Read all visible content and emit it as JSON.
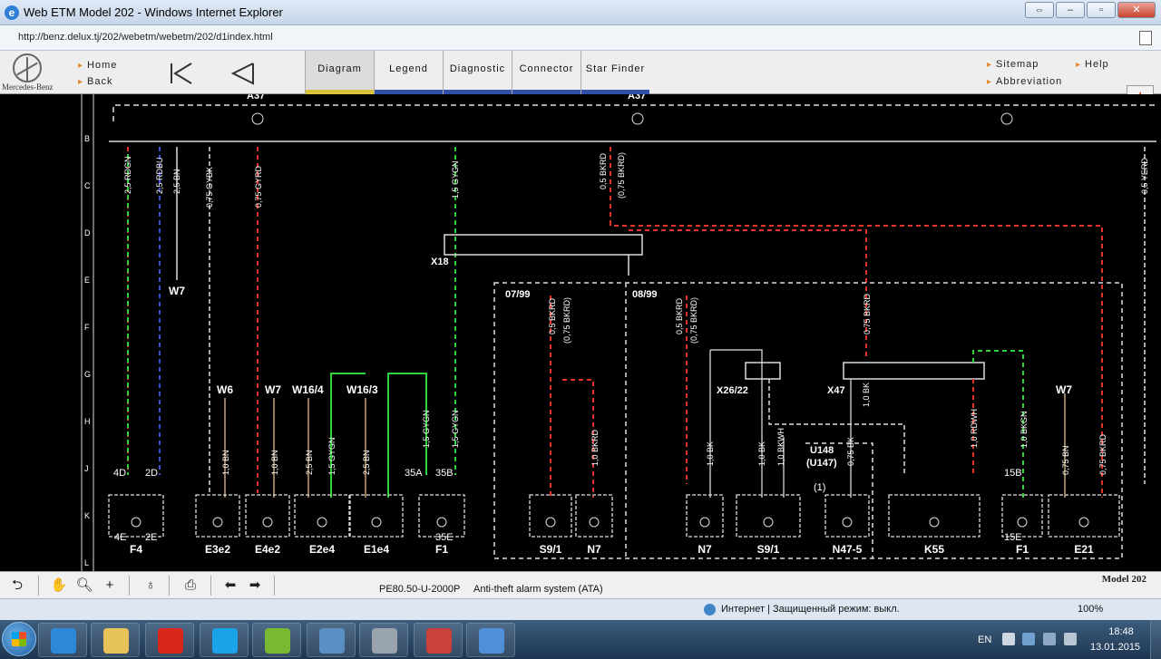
{
  "window": {
    "title": "Web ETM Model 202 - Windows Internet Explorer",
    "url": "http://benz.delux.tj/202/webetm/webetm/202/d1index.html"
  },
  "nav": {
    "brand": "Mercedes-Benz",
    "home": "Home",
    "back": "Back",
    "tabs": [
      {
        "label": "Diagram",
        "bar_color": "#d8c23a"
      },
      {
        "label": "Legend",
        "bar_color": "#2f4fa8"
      },
      {
        "label": "Diagnostic",
        "bar_color": "#2f4fa8"
      },
      {
        "label": "Connector",
        "bar_color": "#2f4fa8"
      },
      {
        "label": "Star Finder",
        "bar_color": "#2f4fa8"
      }
    ],
    "sitemap": "Sitemap",
    "help": "Help",
    "abbreviation": "Abbreviation"
  },
  "diagram": {
    "row_letters": [
      "B",
      "C",
      "D",
      "E",
      "F",
      "G",
      "H",
      "J",
      "K",
      "L"
    ],
    "top_labels": [
      "A37",
      "A37"
    ],
    "connector_labels": [
      "X18",
      "X26/22",
      "X47"
    ],
    "date_labels": [
      "07/99",
      "08/99"
    ],
    "ground_labels": [
      "W7",
      "W6",
      "W7",
      "W16/4",
      "W16/3",
      "W7"
    ],
    "module_labels": [
      "U148",
      "(U147)",
      "(1)"
    ],
    "bottom_components": [
      "F4",
      "E3e2",
      "E4e2",
      "E2e4",
      "E1e4",
      "F1",
      "S9/1",
      "N7",
      "N7",
      "S9/1",
      "N47-5",
      "K55",
      "F1",
      "E21"
    ],
    "fuse_labels": [
      "4D",
      "2D",
      "4E",
      "2E",
      "35A",
      "35B",
      "35E",
      "15B",
      "15E"
    ],
    "wire_labels": [
      "2,5 RDGN",
      "2,5 RDBU",
      "2,5 BN",
      "0,75 GYBK",
      "0,75 GYRD",
      "1,5 GYGN",
      "0,5 BKRD",
      "(0,75 BKRD)",
      "0,5 YERD",
      "0,5 BKRD",
      "(0,75 BKRD)",
      "0,5 BKRD",
      "(0,75 BKRD)",
      "0,75 BKRD",
      "1,0 BN",
      "1,0 BN",
      "2,5 BN",
      "1,5 GYGN",
      "2,5 BN",
      "1,5 GYGN",
      "1,5 GYGN",
      "1,0 BKRD",
      "1,0 BK",
      "1,0 BK",
      "1,0 BKWH",
      "0,75 BK",
      "1,0 BK",
      "1,0 RDWH",
      "1,0 BKGN",
      "0,75 BN",
      "0,75 BKRD"
    ]
  },
  "toolbar": {
    "doc_code": "PE80.50-U-2000P",
    "doc_title": "Anti-theft alarm system (ATA)",
    "model": "Model 202"
  },
  "status": {
    "zone": "Интернет | Защищенный режим: выкл.",
    "zoom": "100%"
  },
  "taskbar": {
    "lang": "EN",
    "time": "18:48",
    "date": "13.01.2015",
    "apps": [
      {
        "name": "internet-explorer",
        "color": "#2e88d8"
      },
      {
        "name": "file-explorer",
        "color": "#e8c35a"
      },
      {
        "name": "opera",
        "color": "#d9261c"
      },
      {
        "name": "skype",
        "color": "#1aa3e8"
      },
      {
        "name": "utorrent",
        "color": "#78b832"
      },
      {
        "name": "photo-viewer",
        "color": "#5a8fc4"
      },
      {
        "name": "tools",
        "color": "#9aa4ad"
      },
      {
        "name": "car-diagnostic",
        "color": "#c9413a"
      },
      {
        "name": "pen-app",
        "color": "#4f8fd8"
      }
    ]
  },
  "colors": {
    "wire_red": "#e8322a",
    "wire_green": "#2fd43a",
    "wire_white": "#d8d8d8",
    "wire_blue": "#3c4fd8",
    "wire_brown": "#c8a27a"
  }
}
